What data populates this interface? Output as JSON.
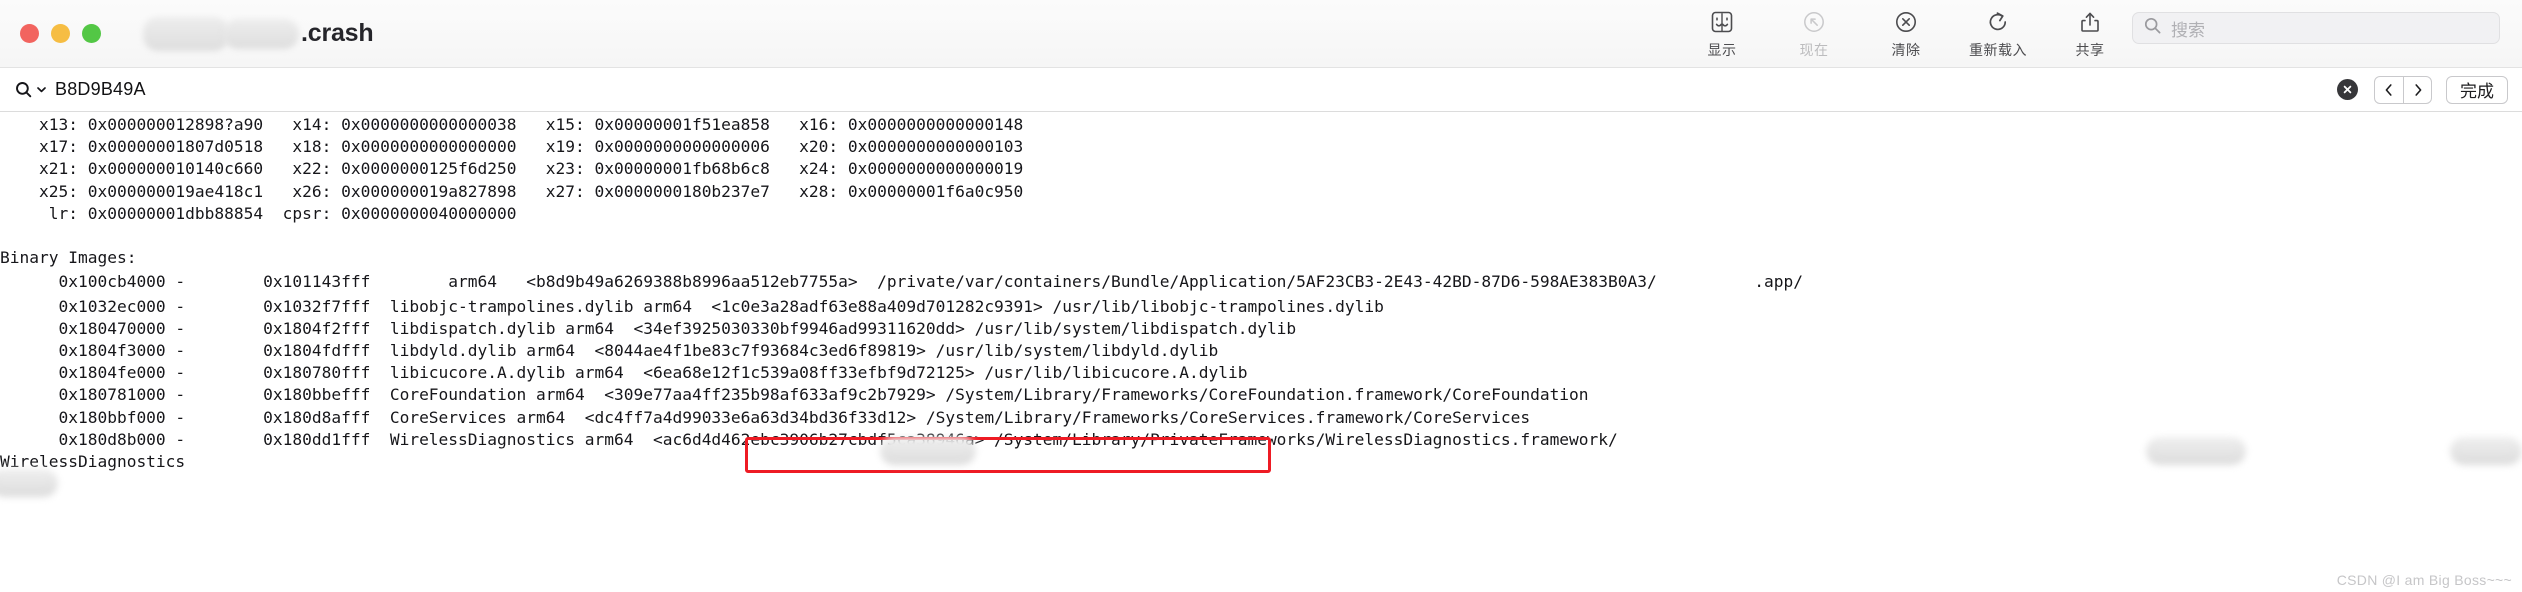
{
  "window": {
    "title_suffix": ".crash",
    "traffic_lights": [
      "close",
      "minimize",
      "zoom"
    ]
  },
  "toolbar": {
    "items": [
      {
        "icon": "finder-icon",
        "label": "显示",
        "disabled": false
      },
      {
        "icon": "now-icon",
        "label": "现在",
        "disabled": true
      },
      {
        "icon": "clear-icon",
        "label": "清除",
        "disabled": false
      },
      {
        "icon": "reload-icon",
        "label": "重新载入",
        "disabled": false
      },
      {
        "icon": "share-icon",
        "label": "共享",
        "disabled": false
      }
    ]
  },
  "search": {
    "placeholder": "搜索",
    "icon": "search-icon"
  },
  "findbar": {
    "value": "B8D9B49A",
    "clear_icon": "close-circle-icon",
    "prev_icon": "chevron-left-icon",
    "next_icon": "chevron-right-icon",
    "done_label": "完成"
  },
  "log": {
    "lines_top": [
      "    x13: 0x000000012898?a90   x14: 0x0000000000000038   x15: 0x00000001f51ea858   x16: 0x0000000000000148",
      "    x17: 0x00000001807d0518   x18: 0x0000000000000000   x19: 0x0000000000000006   x20: 0x0000000000000103",
      "    x21: 0x000000010140c660   x22: 0x0000000125f6d250   x23: 0x00000001fb68b6c8   x24: 0x0000000000000019",
      "    x25: 0x000000019ae418c1   x26: 0x000000019a827898   x27: 0x0000000180b237e7   x28: 0x00000001f6a0c950",
      "     lr: 0x00000001dbb88854  cpsr: 0x0000000040000000",
      "",
      "Binary Images:"
    ],
    "binary_line_highlighted": {
      "addr_start": "      0x100cb4000 - ",
      "addr_end": "       0x101143fff ",
      "redacted_name": true,
      "arch": "arm64",
      "uuid": "<b8d9b49a6269388b8996aa512eb7755a>",
      "path_part_1": " /private/var/containers/Bundle/Application/5AF23CB3-2E43-42BD-87D6-598AE383B0A3/",
      "path_part_2": ".app/"
    },
    "lines_bottom": [
      "      0x1032ec000 -        0x1032f7fff  libobjc-trampolines.dylib arm64  <1c0e3a28adf63e88a409d701282c9391> /usr/lib/libobjc-trampolines.dylib",
      "      0x180470000 -        0x1804f2fff  libdispatch.dylib arm64  <34ef3925030330bf9946ad99311620dd> /usr/lib/system/libdispatch.dylib",
      "      0x1804f3000 -        0x1804fdfff  libdyld.dylib arm64  <8044ae4f1be83c7f93684c3ed6f89819> /usr/lib/system/libdyld.dylib",
      "      0x1804fe000 -        0x180780fff  libicucore.A.dylib arm64  <6ea68e12f1c539a08ff33efbf9d72125> /usr/lib/libicucore.A.dylib",
      "      0x180781000 -        0x180bbefff  CoreFoundation arm64  <309e77aa4ff235b98af633af9c2b7929> /System/Library/Frameworks/CoreFoundation.framework/CoreFoundation",
      "      0x180bbf000 -        0x180d8afff  CoreServices arm64  <dc4ff7a4d99033e6a63d34bd36f33d12> /System/Library/Frameworks/CoreServices.framework/CoreServices",
      "      0x180d8b000 -        0x180dd1fff  WirelessDiagnostics arm64  <ac6d4d462ebc3906b27cbdf5ca38946a> /System/Library/PrivateFrameworks/WirelessDiagnostics.framework/",
      "WirelessDiagnostics"
    ]
  },
  "watermark": "CSDN @I am Big Boss~~~",
  "colors": {
    "highlight_box": "#ee1b24",
    "text": "#16161a",
    "toolbar_label": "#4c4c4f",
    "disabled_label": "#bcbcbe"
  }
}
